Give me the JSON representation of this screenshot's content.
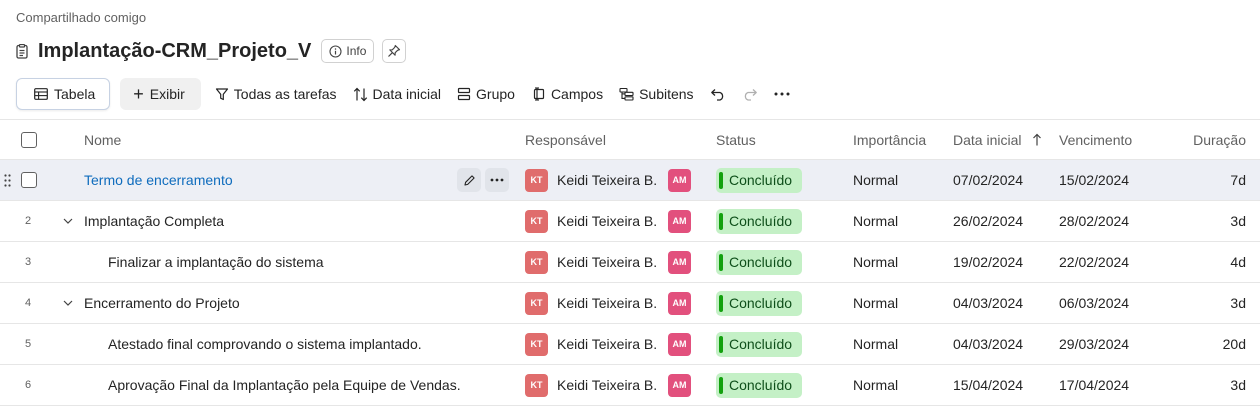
{
  "breadcrumb": "Compartilhado comigo",
  "title": "Implantação-CRM_Projeto_V",
  "info_label": "Info",
  "toolbar": {
    "view_label": "Tabela",
    "exibir_label": "Exibir",
    "filter_label": "Todas as tarefas",
    "sort_label": "Data inicial",
    "group_label": "Grupo",
    "fields_label": "Campos",
    "subitems_label": "Subitens"
  },
  "columns": {
    "name": "Nome",
    "owner": "Responsável",
    "status": "Status",
    "importance": "Importância",
    "start": "Data inicial",
    "due": "Vencimento",
    "duration": "Duração"
  },
  "rows": [
    {
      "num": "",
      "name": "Termo de encerramento",
      "owner_initials": "KT",
      "owner_name": "Keidi Teixeira B.",
      "second_initials": "AM",
      "status": "Concluído",
      "importance": "Normal",
      "start": "07/02/2024",
      "due": "15/02/2024",
      "duration": "7d"
    },
    {
      "num": "2",
      "name": "Implantação Completa",
      "owner_initials": "KT",
      "owner_name": "Keidi Teixeira B.",
      "second_initials": "AM",
      "status": "Concluído",
      "importance": "Normal",
      "start": "26/02/2024",
      "due": "28/02/2024",
      "duration": "3d"
    },
    {
      "num": "3",
      "name": "Finalizar a implantação do sistema",
      "owner_initials": "KT",
      "owner_name": "Keidi Teixeira B.",
      "second_initials": "AM",
      "status": "Concluído",
      "importance": "Normal",
      "start": "19/02/2024",
      "due": "22/02/2024",
      "duration": "4d"
    },
    {
      "num": "4",
      "name": "Encerramento do Projeto",
      "owner_initials": "KT",
      "owner_name": "Keidi Teixeira B.",
      "second_initials": "AM",
      "status": "Concluído",
      "importance": "Normal",
      "start": "04/03/2024",
      "due": "06/03/2024",
      "duration": "3d"
    },
    {
      "num": "5",
      "name": "Atestado final comprovando o sistema implantado.",
      "owner_initials": "KT",
      "owner_name": "Keidi Teixeira B.",
      "second_initials": "AM",
      "status": "Concluído",
      "importance": "Normal",
      "start": "04/03/2024",
      "due": "29/03/2024",
      "duration": "20d"
    },
    {
      "num": "6",
      "name": "Aprovação Final da Implantação pela Equipe de Vendas.",
      "owner_initials": "KT",
      "owner_name": "Keidi Teixeira B.",
      "second_initials": "AM",
      "status": "Concluído",
      "importance": "Normal",
      "start": "15/04/2024",
      "due": "17/04/2024",
      "duration": "3d"
    }
  ],
  "colors": {
    "link": "#0f6cbd",
    "status_bg": "#c4f0c6",
    "status_bar": "#13a10e",
    "avatar_kt": "#e06c6c",
    "avatar_am": "#e2507d",
    "selected_row": "#edeff5"
  },
  "icons": [
    "document-icon",
    "info-icon",
    "pin-icon",
    "table-icon",
    "plus-icon",
    "filter-icon",
    "sort-icon",
    "group-icon",
    "fields-icon",
    "subitems-icon",
    "undo-icon",
    "redo-icon",
    "more-icon",
    "sort-ascending-icon",
    "drag-handle-icon",
    "edit-icon",
    "chevron-down-icon"
  ]
}
